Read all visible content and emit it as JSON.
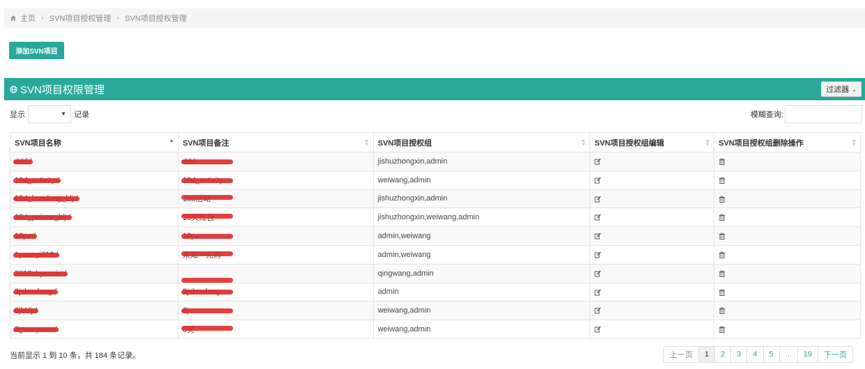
{
  "breadcrumb": {
    "home": "主页",
    "level1": "SVN项目授权管理",
    "level2": "SVN项目授权管理"
  },
  "toolbar": {
    "add_label": "添加SVN项目"
  },
  "panel": {
    "title": "SVN项目权限管理",
    "filter_label": "过滤器"
  },
  "length": {
    "prefix": "显示",
    "suffix": "记录"
  },
  "search": {
    "label": "模糊查询:"
  },
  "table": {
    "headers": [
      "SVN项目名称",
      "SVN项目备注",
      "SVN项目授权组",
      "SVN项目授权组编辑",
      "SVN项目授权组删除操作"
    ],
    "rows": [
      {
        "name": "ddd:/",
        "note": "ddd",
        "groups": "jishuzhongxin,admin"
      },
      {
        "name": "18d_activity:/",
        "note": "18d_activity",
        "groups": "weiwang,admin"
      },
      {
        "name": "18d_huodong_hlj:/",
        "note": "18d活动",
        "groups": "jishuzhongxin,admin"
      },
      {
        "name": "18d_peixun_hlj:/",
        "note": "18天红包",
        "groups": "jishuzhongxin,weiwang,admin"
      },
      {
        "name": "18px:/",
        "note": "18px",
        "groups": "admin,weiwang"
      },
      {
        "name": "1yuanyi618:/",
        "note": "未知一元购",
        "groups": "admin,weiwang"
      },
      {
        "name": "2018zhyouxin:/",
        "note": "",
        "groups": "qingwang,admin"
      },
      {
        "name": "3jshoufeng:/",
        "note": "3jshoufeng",
        "groups": "admin"
      },
      {
        "name": "6jbhlj:/",
        "note": "6j",
        "groups": "weiwang,admin"
      },
      {
        "name": "6guanyuan:/",
        "note": "6关",
        "groups": "weiwang,admin"
      }
    ],
    "edit_icon": "edit-icon",
    "delete_icon": "trash-icon"
  },
  "info": {
    "text": "当前显示 1 到 10 条，共 184 条记录。"
  },
  "pager": {
    "prev": "上一页",
    "pages": [
      "1",
      "2",
      "3",
      "4",
      "5",
      "...",
      "19"
    ],
    "next": "下一页"
  },
  "colors": {
    "accent": "#2aa89a",
    "redaction": "#e02a2a"
  }
}
